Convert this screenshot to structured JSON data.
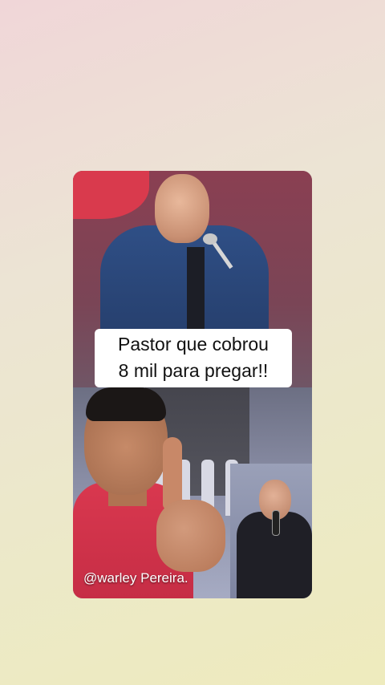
{
  "caption": {
    "line1": "Pastor que cobrou",
    "line2": "8 mil para pregar!!"
  },
  "handle": "@warley Pereira.",
  "colors": {
    "background_top": "#f0d6d8",
    "background_bottom": "#eeebbd",
    "caption_bg": "#ffffff",
    "banner_red": "#d93a4d",
    "shirt_red": "#d9384f"
  }
}
